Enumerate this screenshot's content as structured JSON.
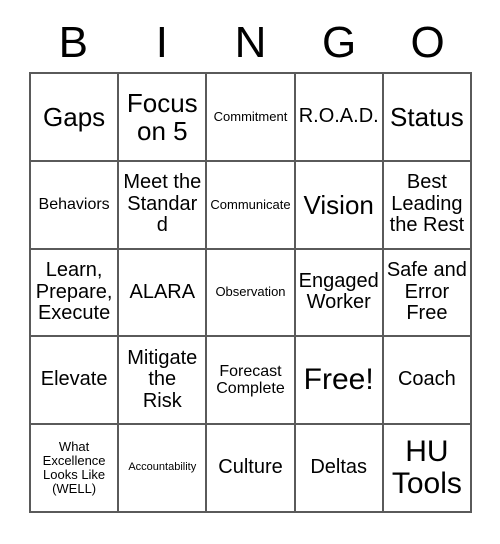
{
  "card": {
    "title": "BINGO",
    "header_letters": [
      "B",
      "I",
      "N",
      "G",
      "O"
    ],
    "free_space": "Free!",
    "colors": {
      "background": "#ffffff",
      "border": "#5a5a5a",
      "text": "#000000"
    },
    "grid": {
      "columns": 5,
      "rows": 5,
      "cells": [
        {
          "text": "Gaps",
          "size": "xl"
        },
        {
          "text": "Focus\non 5",
          "size": "xl"
        },
        {
          "text": "Commitment",
          "size": "xs"
        },
        {
          "text": "R.O.A.D.",
          "size": "md"
        },
        {
          "text": "Status",
          "size": "xl"
        },
        {
          "text": "Behaviors",
          "size": "sm"
        },
        {
          "text": "Meet the\nStandard",
          "size": "md"
        },
        {
          "text": "Communicate",
          "size": "xs"
        },
        {
          "text": "Vision",
          "size": "xl"
        },
        {
          "text": "Best\nLeading\nthe Rest",
          "size": "md"
        },
        {
          "text": "Learn,\nPrepare,\nExecute",
          "size": "md"
        },
        {
          "text": "ALARA",
          "size": "md"
        },
        {
          "text": "Observation",
          "size": "xs"
        },
        {
          "text": "Engaged\nWorker",
          "size": "md"
        },
        {
          "text": "Safe and\nError\nFree",
          "size": "md"
        },
        {
          "text": "Elevate",
          "size": "md"
        },
        {
          "text": "Mitigate\nthe\nRisk",
          "size": "md"
        },
        {
          "text": "Forecast\nComplete",
          "size": "sm"
        },
        {
          "text": "Free!",
          "size": "xxl"
        },
        {
          "text": "Coach",
          "size": "md"
        },
        {
          "text": "What\nExcellence\nLooks Like\n(WELL)",
          "size": "xs"
        },
        {
          "text": "Accountability",
          "size": "xxs"
        },
        {
          "text": "Culture",
          "size": "md"
        },
        {
          "text": "Deltas",
          "size": "md"
        },
        {
          "text": "HU\nTools",
          "size": "xxl"
        }
      ]
    }
  }
}
